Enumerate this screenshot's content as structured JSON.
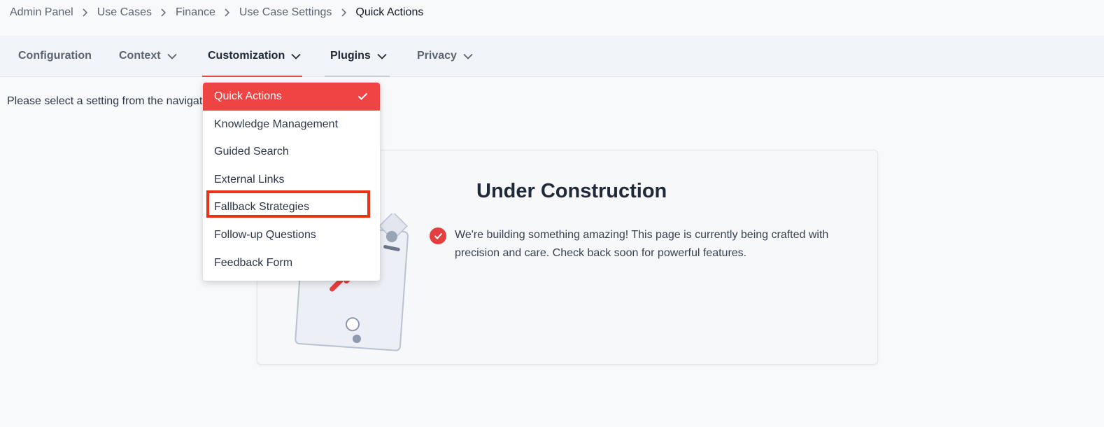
{
  "breadcrumb": {
    "items": [
      "Admin Panel",
      "Use Cases",
      "Finance",
      "Use Case Settings",
      "Quick Actions"
    ]
  },
  "tabs": [
    {
      "label": "Configuration"
    },
    {
      "label": "Context"
    },
    {
      "label": "Customization"
    },
    {
      "label": "Plugins"
    },
    {
      "label": "Privacy"
    }
  ],
  "main": {
    "instruction": "Please select a setting from the navigation menu above."
  },
  "card": {
    "title": "Under Construction",
    "text": "We're building something amazing! This page is currently being crafted with precision and care. Check back soon for powerful features."
  },
  "dropdown": {
    "items": [
      {
        "label": "Quick Actions"
      },
      {
        "label": "Knowledge Management"
      },
      {
        "label": "Guided Search"
      },
      {
        "label": "External Links"
      },
      {
        "label": "Fallback Strategies"
      },
      {
        "label": "Follow-up Questions"
      },
      {
        "label": "Feedback Form"
      }
    ]
  },
  "colors": {
    "accent": "#ef4444",
    "highlight": "#e8321a",
    "tab_bar": "#f1f4f8",
    "background": "#f8f9fb"
  },
  "icons": {
    "breadcrumb_separator": "chevron-right-icon",
    "tab_dropdown": "chevron-down-icon",
    "selected": "check-icon",
    "badge": "check-circle-icon"
  }
}
